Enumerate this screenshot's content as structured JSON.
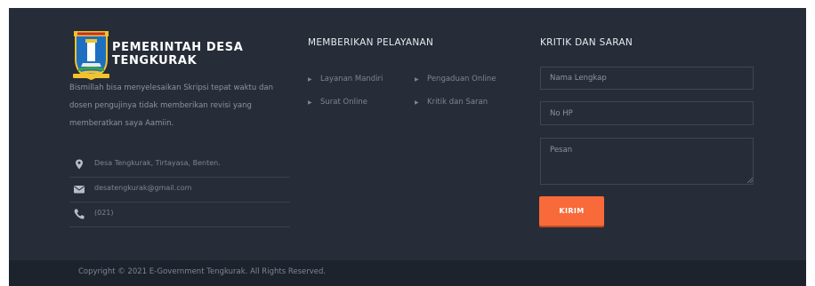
{
  "brand": {
    "name_line1": "PEMERINTAH DESA",
    "name_line2": "TENGKURAK",
    "description": "Bismillah bisa menyelesaikan Skripsi tepat waktu dan dosen pengujinya tidak memberikan revisi yang memberatkan saya Aamiin."
  },
  "contacts": [
    {
      "icon": "location-pin-icon",
      "text": "Desa Tengkurak, Tirtayasa, Benten."
    },
    {
      "icon": "envelope-icon",
      "text": "desatengkurak@gmail.com"
    },
    {
      "icon": "phone-icon",
      "text": "(021)"
    }
  ],
  "services": {
    "title": "MEMBERIKAN PELAYANAN",
    "items": [
      "Layanan Mandiri",
      "Pengaduan Online",
      "Surat Online",
      "Kritik dan Saran"
    ]
  },
  "feedback": {
    "title": "KRITIK DAN SARAN",
    "name_placeholder": "Nama Lengkap",
    "phone_placeholder": "No HP",
    "message_placeholder": "Pesan",
    "submit_label": "KIRIM"
  },
  "copyright": "Copyright © 2021 E-Government Tengkurak. All Rights Reserved.",
  "colors": {
    "footer_bg": "#262d38",
    "bottom_bar_bg": "#1d232c",
    "accent": "#f86a3a"
  }
}
